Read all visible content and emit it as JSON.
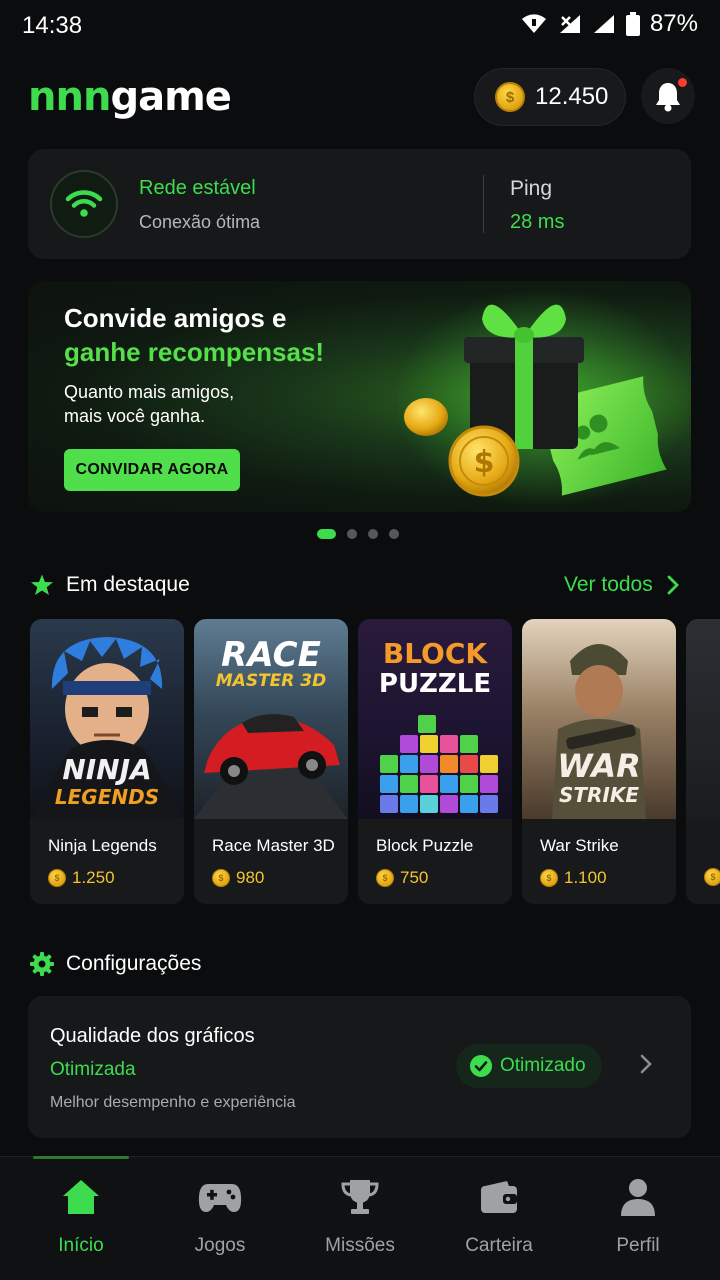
{
  "status_bar": {
    "time": "14:38",
    "battery": "87%"
  },
  "header": {
    "logo_part1": "nnn",
    "logo_part2": "game",
    "coins": "12.450"
  },
  "network": {
    "title": "Rede estável",
    "subtitle": "Conexão ótima",
    "ping_label": "Ping",
    "ping_value": "28 ms"
  },
  "banner": {
    "title_line1": "Convide amigos e",
    "title_line2": "ganhe recompensas!",
    "desc_line1": "Quanto mais amigos,",
    "desc_line2": "mais você ganha.",
    "button": "CONVIDAR AGORA",
    "pages": 4,
    "active_page": 1
  },
  "featured": {
    "title": "Em destaque",
    "see_all": "Ver todos",
    "games": [
      {
        "name": "Ninja Legends",
        "price": "1.250",
        "art_line1": "NINJA",
        "art_line2": "LEGENDS"
      },
      {
        "name": "Race Master 3D",
        "price": "980",
        "art_line1": "RACE",
        "art_line2": "MASTER 3D"
      },
      {
        "name": "Block Puzzle",
        "price": "750",
        "art_line1": "BLOCK",
        "art_line2": "PUZZLE"
      },
      {
        "name": "War Strike",
        "price": "1.100",
        "art_line1": "WAR",
        "art_line2": "STRIKE"
      }
    ]
  },
  "settings": {
    "title": "Configurações",
    "item_title": "Qualidade dos gráficos",
    "item_value": "Otimizada",
    "item_desc": "Melhor desempenho e experiência",
    "badge": "Otimizado"
  },
  "nav": [
    {
      "label": "Início",
      "icon": "home-icon",
      "active": true
    },
    {
      "label": "Jogos",
      "icon": "gamepad-icon",
      "active": false
    },
    {
      "label": "Missões",
      "icon": "trophy-icon",
      "active": false
    },
    {
      "label": "Carteira",
      "icon": "wallet-icon",
      "active": false
    },
    {
      "label": "Perfil",
      "icon": "user-icon",
      "active": false
    }
  ],
  "colors": {
    "accent": "#3ddc4f",
    "background": "#0b0c0d",
    "card": "#16181a",
    "coin": "#f4c430"
  }
}
